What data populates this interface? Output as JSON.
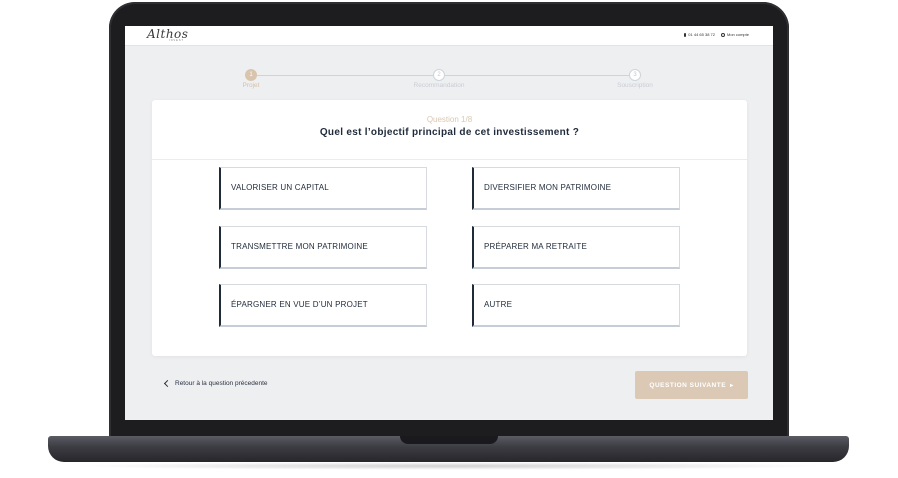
{
  "header": {
    "logo": "Althos",
    "logo_sub": "INVEST",
    "phone": "01 44 65 38 72",
    "account": "Mon compte"
  },
  "stepper": {
    "steps": [
      {
        "num": "1",
        "label": "Projet",
        "state": "active"
      },
      {
        "num": "2",
        "label": "Recommandation",
        "state": "idle"
      },
      {
        "num": "3",
        "label": "Souscription",
        "state": "idle"
      }
    ]
  },
  "question": {
    "counter": "Question 1/8",
    "title": "Quel est l’objectif principal de cet investissement ?",
    "options": [
      "VALORISER UN CAPITAL",
      "DIVERSIFIER MON PATRIMOINE",
      "TRANSMETTRE MON PATRIMOINE",
      "PRÉPARER MA RETRAITE",
      "ÉPARGNER EN VUE D’UN PROJET",
      "AUTRE"
    ]
  },
  "footer": {
    "back_label": "Retour à la question précedente",
    "next_label": "QUESTION SUIVANTE",
    "next_icon": "chevron-right-icon"
  },
  "colors": {
    "accent": "#d9c4ad",
    "navy": "#1f2a3a",
    "screen_bg": "#eeeff1"
  }
}
